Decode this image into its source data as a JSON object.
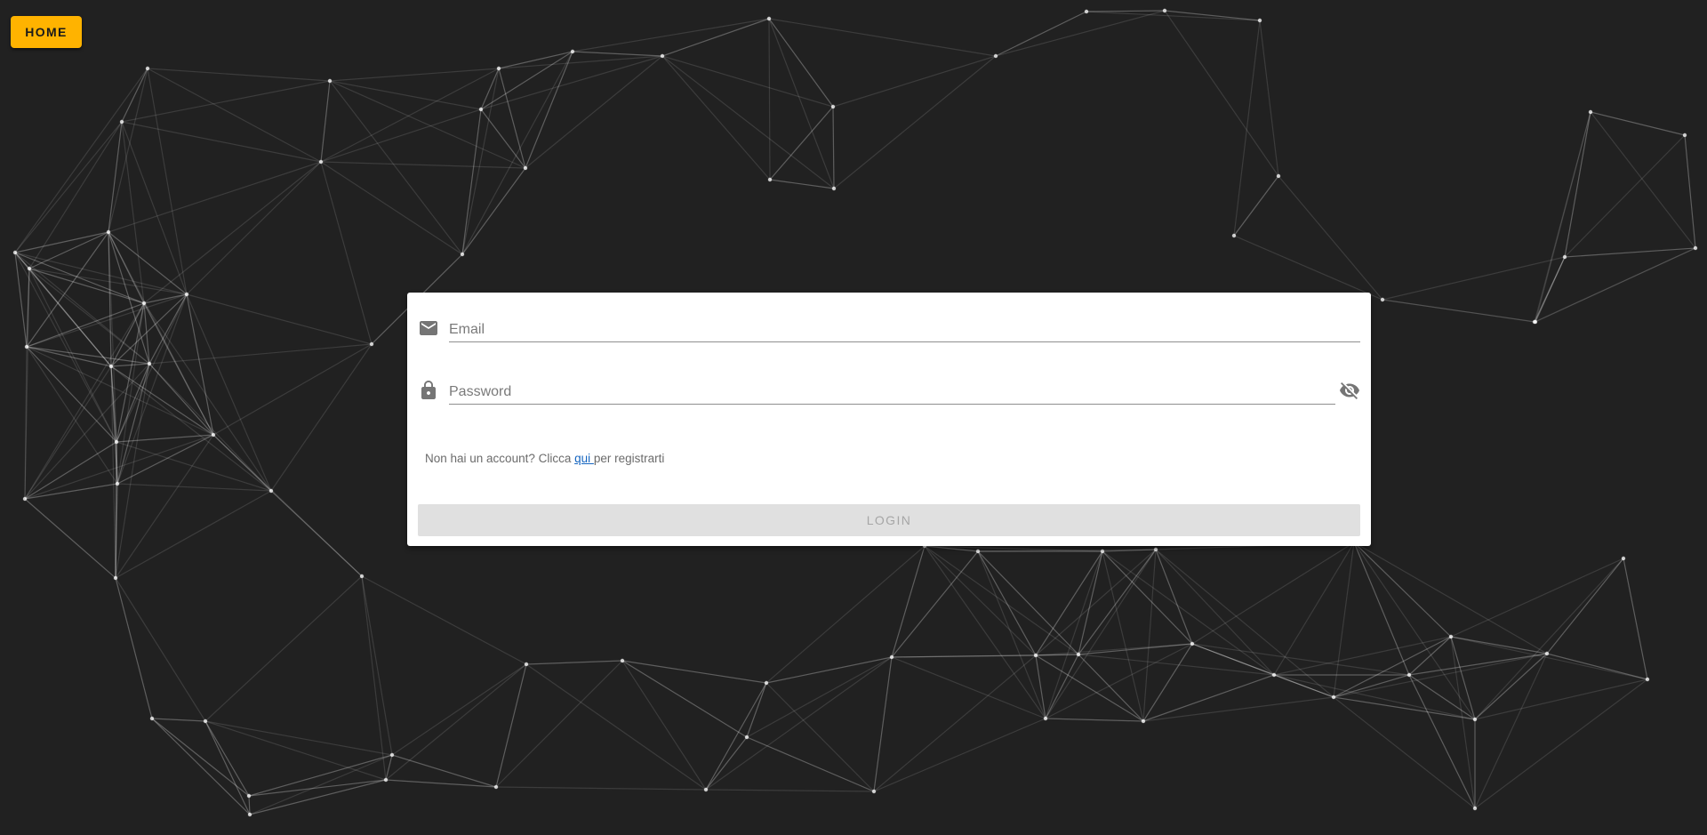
{
  "header": {
    "home_label": "HOME"
  },
  "login_form": {
    "email": {
      "placeholder": "Email",
      "value": ""
    },
    "password": {
      "placeholder": "Password",
      "value": ""
    },
    "signup": {
      "prefix": "Non hai un account? Clicca ",
      "link": "qui ",
      "suffix": "per registrarti"
    },
    "login_label": "LOGIN"
  },
  "colors": {
    "background": "#212121",
    "home_button": "#ffb300",
    "link": "#1565c0",
    "disabled_button": "#e0e0e0"
  },
  "icons": {
    "email": "email-icon",
    "password": "lock-icon",
    "visibility": "visibility-off-icon"
  }
}
